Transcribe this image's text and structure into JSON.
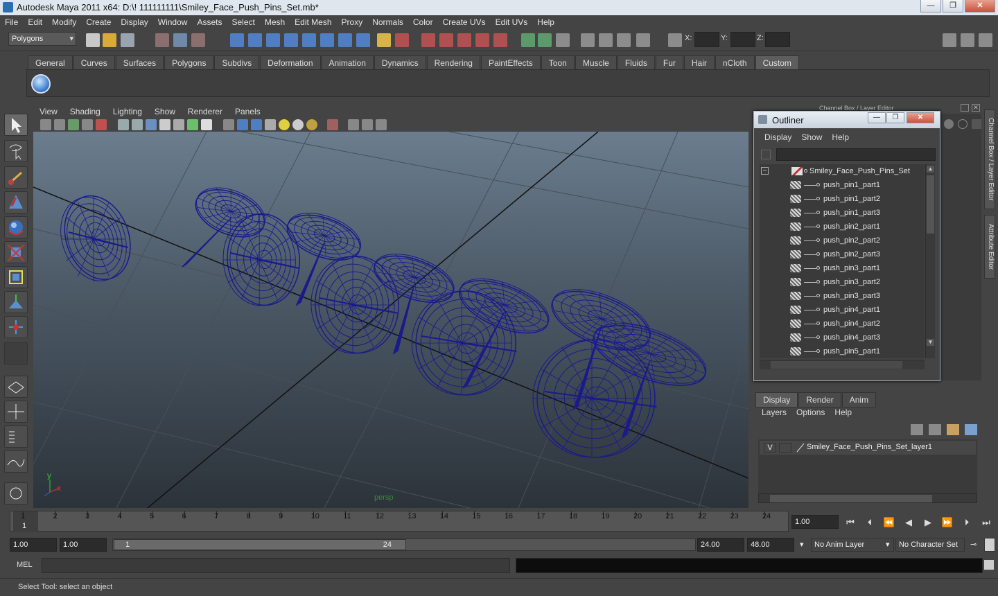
{
  "window": {
    "title": "Autodesk Maya 2011 x64: D:\\! 111111111\\Smiley_Face_Push_Pins_Set.mb*",
    "min": "—",
    "max": "❐",
    "close": "✕"
  },
  "menubar": [
    "File",
    "Edit",
    "Modify",
    "Create",
    "Display",
    "Window",
    "Assets",
    "Select",
    "Mesh",
    "Edit Mesh",
    "Proxy",
    "Normals",
    "Color",
    "Create UVs",
    "Edit UVs",
    "Help"
  ],
  "status": {
    "mode": "Polygons",
    "x_label": "X:",
    "y_label": "Y:",
    "z_label": "Z:"
  },
  "shelf": {
    "tabs": [
      "General",
      "Curves",
      "Surfaces",
      "Polygons",
      "Subdivs",
      "Deformation",
      "Animation",
      "Dynamics",
      "Rendering",
      "PaintEffects",
      "Toon",
      "Muscle",
      "Fluids",
      "Fur",
      "Hair",
      "nCloth",
      "Custom"
    ],
    "active": "Custom"
  },
  "viewport": {
    "menu": [
      "View",
      "Shading",
      "Lighting",
      "Show",
      "Renderer",
      "Panels"
    ],
    "camera": "persp",
    "axis_x": "x",
    "axis_y": "y",
    "wire_color": "#1a1a8c"
  },
  "channelbox": {
    "header": "Channel Box / Layer Editor",
    "side_tabs": [
      "Channel Box / Layer Editor",
      "Attribute Editor"
    ]
  },
  "outliner": {
    "title": "Outliner",
    "menu": [
      "Display",
      "Show",
      "Help"
    ],
    "root": "Smiley_Face_Push_Pins_Set",
    "items": [
      "push_pin1_part1",
      "push_pin1_part2",
      "push_pin1_part3",
      "push_pin2_part1",
      "push_pin2_part2",
      "push_pin2_part3",
      "push_pin3_part1",
      "push_pin3_part2",
      "push_pin3_part3",
      "push_pin4_part1",
      "push_pin4_part2",
      "push_pin4_part3",
      "push_pin5_part1"
    ]
  },
  "layers": {
    "tabs": [
      "Display",
      "Render",
      "Anim"
    ],
    "active": "Display",
    "menu": [
      "Layers",
      "Options",
      "Help"
    ],
    "layer": {
      "visible": "V",
      "name": "Smiley_Face_Push_Pins_Set_layer1"
    }
  },
  "timeline": {
    "ticks": [
      "1",
      "2",
      "3",
      "4",
      "5",
      "6",
      "7",
      "8",
      "9",
      "10",
      "11",
      "12",
      "13",
      "14",
      "15",
      "16",
      "17",
      "18",
      "19",
      "20",
      "21",
      "22",
      "23",
      "24"
    ],
    "current": "1",
    "current_field": "1.00"
  },
  "range": {
    "start": "1.00",
    "anim_start": "1.00",
    "thumb_start": "1",
    "thumb_end": "24",
    "anim_end": "24.00",
    "end": "48.00",
    "anim_layer": "No Anim Layer",
    "char_set": "No Character Set"
  },
  "cmd": {
    "label": "MEL"
  },
  "help": {
    "text": "Select Tool: select an object"
  }
}
